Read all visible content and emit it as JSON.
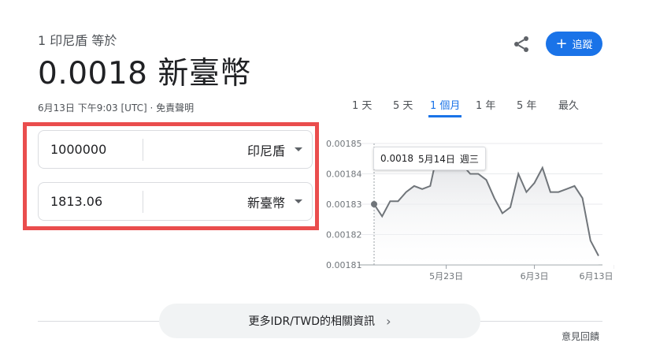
{
  "header": {
    "subtitle": "1 印尼盾 等於",
    "rate": "0.0018 新臺幣",
    "timestamp": "6月13日 下午9:03 [UTC] · 免責聲明",
    "follow_label": "追蹤",
    "follow_color": "#1a73e8",
    "share_icon": "share-icon"
  },
  "range_tabs": [
    "1 天",
    "5 天",
    "1 個月",
    "1 年",
    "5 年",
    "最久"
  ],
  "active_tab": "1 個月",
  "converter": {
    "from": {
      "value": "1000000",
      "currency": "印尼盾"
    },
    "to": {
      "value": "1813.06",
      "currency": "新臺幣"
    },
    "highlight_color": "#ea4d4d"
  },
  "chart_data": {
    "type": "area",
    "x": [
      "5月14日",
      "5月15日",
      "5月16日",
      "5月17日",
      "5月18日",
      "5月19日",
      "5月20日",
      "5月21日",
      "5月22日",
      "5月23日",
      "5月24日",
      "5月25日",
      "5月26日",
      "5月27日",
      "5月28日",
      "5月29日",
      "5月30日",
      "5月31日",
      "6月1日",
      "6月2日",
      "6月3日",
      "6月4日",
      "6月5日",
      "6月6日",
      "6月7日",
      "6月8日",
      "6月9日",
      "6月10日",
      "6月11日",
      "6月12日",
      "6月13日"
    ],
    "values": [
      0.00183,
      0.001826,
      0.001831,
      0.001831,
      0.001834,
      0.001836,
      0.001835,
      0.001836,
      0.001848,
      0.001848,
      0.001845,
      0.001843,
      0.00184,
      0.00184,
      0.001838,
      0.001832,
      0.001827,
      0.001829,
      0.00184,
      0.001834,
      0.001837,
      0.001842,
      0.001834,
      0.001834,
      0.001835,
      0.001836,
      0.001832,
      0.001818,
      0.001813
    ],
    "y_ticks": [
      "0.00185",
      "0.00184",
      "0.00183",
      "0.00182",
      "0.00181"
    ],
    "x_ticks": [
      "5月23日",
      "6月3日",
      "6月13日"
    ],
    "ylim": [
      0.00181,
      0.00185
    ],
    "grid": true,
    "line_color": "#70757a"
  },
  "tooltip": {
    "value": "0.0018",
    "date": "5月14日",
    "weekday": "週三"
  },
  "footer": {
    "more_label": "更多IDR/TWD的相關資訊",
    "feedback": "意見回饋"
  }
}
